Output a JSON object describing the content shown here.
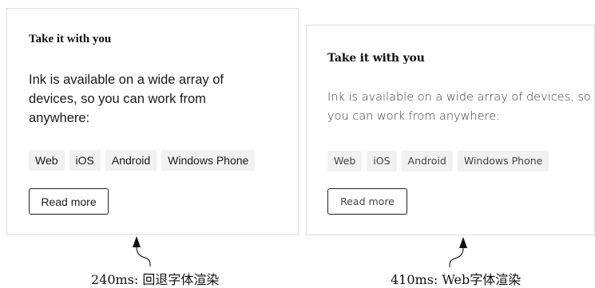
{
  "cards": [
    {
      "title": "Take it with you",
      "body": "Ink is available on a wide array of devices, so you can work from anywhere:",
      "tags": [
        "Web",
        "iOS",
        "Android",
        "Windows Phone"
      ],
      "button_label": "Read more"
    },
    {
      "title": "Take it with you",
      "body": "Ink is available on a wide array of devices, so you can work from anywhere:",
      "tags": [
        "Web",
        "iOS",
        "Android",
        "Windows Phone"
      ],
      "button_label": "Read more"
    }
  ],
  "captions": {
    "left": "240ms:  回退字体渲染",
    "right": "410ms:  Web字体渲染"
  },
  "icons": {
    "pointer_arrow": "curved-up-arrow-icon"
  },
  "colors": {
    "card_border": "#dcdcdc",
    "tag_background": "#f1f1f1",
    "button_border": "#222222",
    "text": "#1a1a1a"
  }
}
